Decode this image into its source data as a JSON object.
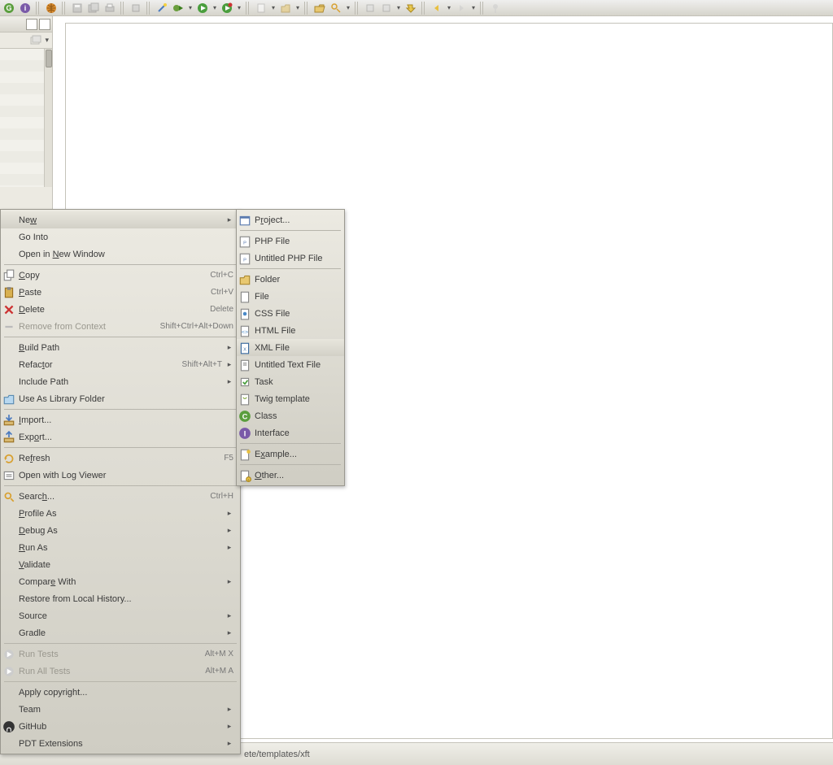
{
  "toolbar": {
    "groups": [
      {
        "items": [
          {
            "name": "g-icon",
            "svg": "g"
          },
          {
            "name": "info-icon",
            "svg": "info"
          }
        ]
      },
      {
        "items": [
          {
            "name": "globe-icon",
            "svg": "globe"
          }
        ]
      },
      {
        "items": [
          {
            "name": "save-icon",
            "svg": "save",
            "disabled": true
          },
          {
            "name": "save-all-icon",
            "svg": "saveall",
            "disabled": true
          },
          {
            "name": "print-icon",
            "svg": "print",
            "disabled": true
          }
        ]
      },
      {
        "items": [
          {
            "name": "build-icon",
            "svg": "build",
            "disabled": true
          }
        ]
      },
      {
        "items": [
          {
            "name": "wand-icon",
            "svg": "wand"
          },
          {
            "name": "bug-run-icon",
            "svg": "bugplay",
            "arrow": true
          },
          {
            "name": "run-icon",
            "svg": "play",
            "arrow": true
          },
          {
            "name": "ext-run-icon",
            "svg": "extplay",
            "arrow": true
          }
        ]
      },
      {
        "items": [
          {
            "name": "new-file-icon",
            "svg": "newfile",
            "arrow": true,
            "disabled": true
          },
          {
            "name": "new-folder-icon",
            "svg": "newfolder",
            "arrow": true,
            "disabled": true
          }
        ]
      },
      {
        "items": [
          {
            "name": "open-folder-icon",
            "svg": "openfolder"
          },
          {
            "name": "search-icon",
            "svg": "searchwand",
            "arrow": true
          }
        ]
      },
      {
        "items": [
          {
            "name": "prev-icon",
            "svg": "prevmark",
            "disabled": true
          },
          {
            "name": "next-icon",
            "svg": "nextmark",
            "arrow": true,
            "disabled": true
          },
          {
            "name": "step-icon",
            "svg": "stepmark"
          }
        ]
      },
      {
        "items": [
          {
            "name": "back-icon",
            "svg": "back",
            "arrow": true
          },
          {
            "name": "fwd-icon",
            "svg": "fwd",
            "arrow": true,
            "disabled": true
          }
        ]
      },
      {
        "items": [
          {
            "name": "pin-icon",
            "svg": "pin",
            "disabled": true
          }
        ]
      }
    ]
  },
  "context_menu": {
    "items": [
      {
        "kind": "item",
        "icon": null,
        "label_pre": "Ne",
        "label_u": "w",
        "label_post": "",
        "sub": true,
        "highlight": true,
        "name": "ctx-new"
      },
      {
        "kind": "item",
        "icon": null,
        "label_pre": "Go Into",
        "name": "ctx-go-into"
      },
      {
        "kind": "item",
        "icon": null,
        "label_pre": "Open in ",
        "label_u": "N",
        "label_post": "ew Window",
        "name": "ctx-open-new-window"
      },
      {
        "kind": "sep"
      },
      {
        "kind": "item",
        "icon": "copy",
        "label_u": "C",
        "label_post": "opy",
        "accel": "Ctrl+C",
        "name": "ctx-copy"
      },
      {
        "kind": "item",
        "icon": "paste",
        "label_u": "P",
        "label_post": "aste",
        "accel": "Ctrl+V",
        "name": "ctx-paste"
      },
      {
        "kind": "item",
        "icon": "delete",
        "label_u": "D",
        "label_post": "elete",
        "accel": "Delete",
        "name": "ctx-delete"
      },
      {
        "kind": "item",
        "icon": "removectx",
        "label_pre": "Remove from Context",
        "accel": "Shift+Ctrl+Alt+Down",
        "disabled": true,
        "name": "ctx-remove-context"
      },
      {
        "kind": "sep"
      },
      {
        "kind": "item",
        "icon": null,
        "label_u": "B",
        "label_post": "uild Path",
        "sub": true,
        "name": "ctx-build-path"
      },
      {
        "kind": "item",
        "icon": null,
        "label_pre": "Refac",
        "label_u": "t",
        "label_post": "or",
        "accel": "Shift+Alt+T",
        "sub": true,
        "name": "ctx-refactor"
      },
      {
        "kind": "item",
        "icon": null,
        "label_pre": "Include Path",
        "sub": true,
        "name": "ctx-include-path"
      },
      {
        "kind": "item",
        "icon": "libfolder",
        "label_pre": "Use As Library Folder",
        "name": "ctx-lib-folder"
      },
      {
        "kind": "sep"
      },
      {
        "kind": "item",
        "icon": "import",
        "label_u": "I",
        "label_post": "mport...",
        "name": "ctx-import"
      },
      {
        "kind": "item",
        "icon": "export",
        "label_pre": "Exp",
        "label_u": "o",
        "label_post": "rt...",
        "name": "ctx-export"
      },
      {
        "kind": "sep"
      },
      {
        "kind": "item",
        "icon": "refresh",
        "label_pre": "Re",
        "label_u": "f",
        "label_post": "resh",
        "accel": "F5",
        "name": "ctx-refresh"
      },
      {
        "kind": "item",
        "icon": "logview",
        "label_pre": "Open with Log Viewer",
        "name": "ctx-log-viewer"
      },
      {
        "kind": "sep"
      },
      {
        "kind": "item",
        "icon": "search",
        "label_pre": "Searc",
        "label_u": "h",
        "label_post": "...",
        "accel": "Ctrl+H",
        "name": "ctx-search"
      },
      {
        "kind": "item",
        "icon": null,
        "label_u": "P",
        "label_post": "rofile As",
        "sub": true,
        "name": "ctx-profile-as"
      },
      {
        "kind": "item",
        "icon": null,
        "label_u": "D",
        "label_post": "ebug As",
        "sub": true,
        "name": "ctx-debug-as"
      },
      {
        "kind": "item",
        "icon": null,
        "label_u": "R",
        "label_post": "un As",
        "sub": true,
        "name": "ctx-run-as"
      },
      {
        "kind": "item",
        "icon": null,
        "label_u": "V",
        "label_post": "alidate",
        "name": "ctx-validate"
      },
      {
        "kind": "item",
        "icon": null,
        "label_pre": "Compar",
        "label_u": "e",
        "label_post": " With",
        "sub": true,
        "name": "ctx-compare-with"
      },
      {
        "kind": "item",
        "icon": null,
        "label_pre": "Restore from Local History...",
        "name": "ctx-restore-history"
      },
      {
        "kind": "item",
        "icon": null,
        "label_pre": "Source",
        "sub": true,
        "name": "ctx-source"
      },
      {
        "kind": "item",
        "icon": null,
        "label_pre": "Gradle",
        "sub": true,
        "name": "ctx-gradle"
      },
      {
        "kind": "sep"
      },
      {
        "kind": "item",
        "icon": "runtest",
        "label_pre": "Run Tests",
        "accel": "Alt+M X",
        "disabled": true,
        "name": "ctx-run-tests"
      },
      {
        "kind": "item",
        "icon": "runtest",
        "label_pre": "Run All Tests",
        "accel": "Alt+M A",
        "disabled": true,
        "name": "ctx-run-all-tests"
      },
      {
        "kind": "sep"
      },
      {
        "kind": "item",
        "icon": null,
        "label_pre": "Apply copyright...",
        "name": "ctx-apply-copyright"
      },
      {
        "kind": "item",
        "icon": null,
        "label_pre": "Team",
        "sub": true,
        "name": "ctx-team"
      },
      {
        "kind": "item",
        "icon": "github",
        "label_pre": "GitHub",
        "sub": true,
        "name": "ctx-github"
      },
      {
        "kind": "item",
        "icon": null,
        "label_pre": "PDT Extensions",
        "sub": true,
        "name": "ctx-pdt-ext"
      }
    ]
  },
  "submenu_new": {
    "items": [
      {
        "icon": "project",
        "label_pre": "P",
        "label_u": "r",
        "label_post": "oject...",
        "name": "new-project"
      },
      {
        "kind": "sep"
      },
      {
        "icon": "php",
        "label_pre": "PHP File",
        "name": "new-php-file"
      },
      {
        "icon": "phpu",
        "label_pre": "Untitled PHP File",
        "name": "new-untitled-php"
      },
      {
        "kind": "sep"
      },
      {
        "icon": "folder",
        "label_pre": "Folder",
        "name": "new-folder"
      },
      {
        "icon": "file",
        "label_pre": "File",
        "name": "new-file"
      },
      {
        "icon": "css",
        "label_pre": "CSS File",
        "name": "new-css"
      },
      {
        "icon": "html",
        "label_pre": "HTML File",
        "name": "new-html"
      },
      {
        "icon": "xml",
        "label_pre": "XML File",
        "highlight": true,
        "name": "new-xml"
      },
      {
        "icon": "txt",
        "label_pre": "Untitled Text File",
        "name": "new-txt"
      },
      {
        "icon": "task",
        "label_pre": "Task",
        "name": "new-task"
      },
      {
        "icon": "twig",
        "label_pre": "Twig template",
        "name": "new-twig"
      },
      {
        "icon": "class",
        "label_pre": "Class",
        "name": "new-class"
      },
      {
        "icon": "iface",
        "label_pre": "Interface",
        "name": "new-interface"
      },
      {
        "kind": "sep"
      },
      {
        "icon": "example",
        "label_pre": "E",
        "label_u": "x",
        "label_post": "ample...",
        "name": "new-example"
      },
      {
        "kind": "sep"
      },
      {
        "icon": "other",
        "label_u": "O",
        "label_post": "ther...",
        "name": "new-other"
      }
    ]
  },
  "status_text": "ete/templates/xft"
}
